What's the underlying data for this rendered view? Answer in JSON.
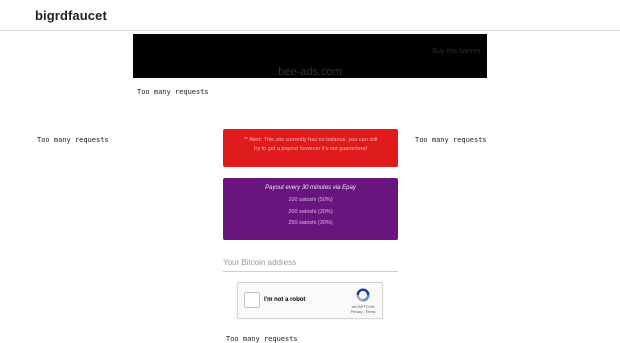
{
  "header": {
    "brand": "bigrdfaucet"
  },
  "ad": {
    "text": "bee-ads.com",
    "corner": "Buy this banner"
  },
  "messages": {
    "too_many_top": "Too many requests",
    "too_many_left": "Too many requests",
    "too_many_right": "Too many requests",
    "too_many_bottom": "Too many requests"
  },
  "alert": {
    "line1": "** Alert: This site currently has no balance, you can still",
    "line2": "try to get a payout however it's not guaranteed",
    "color": "#e01b1b"
  },
  "payout": {
    "title": "Payout every 30 minutes via Epay",
    "rows": [
      "100 satoshi (50%)",
      "200 satoshi (20%)",
      "250 satoshi (30%)"
    ],
    "color": "#6a1480"
  },
  "address_input": {
    "placeholder": "Your Bitcoin address",
    "value": ""
  },
  "captcha": {
    "label": "I'm not a robot",
    "brand": "reCAPTCHA",
    "links": "Privacy - Terms"
  }
}
